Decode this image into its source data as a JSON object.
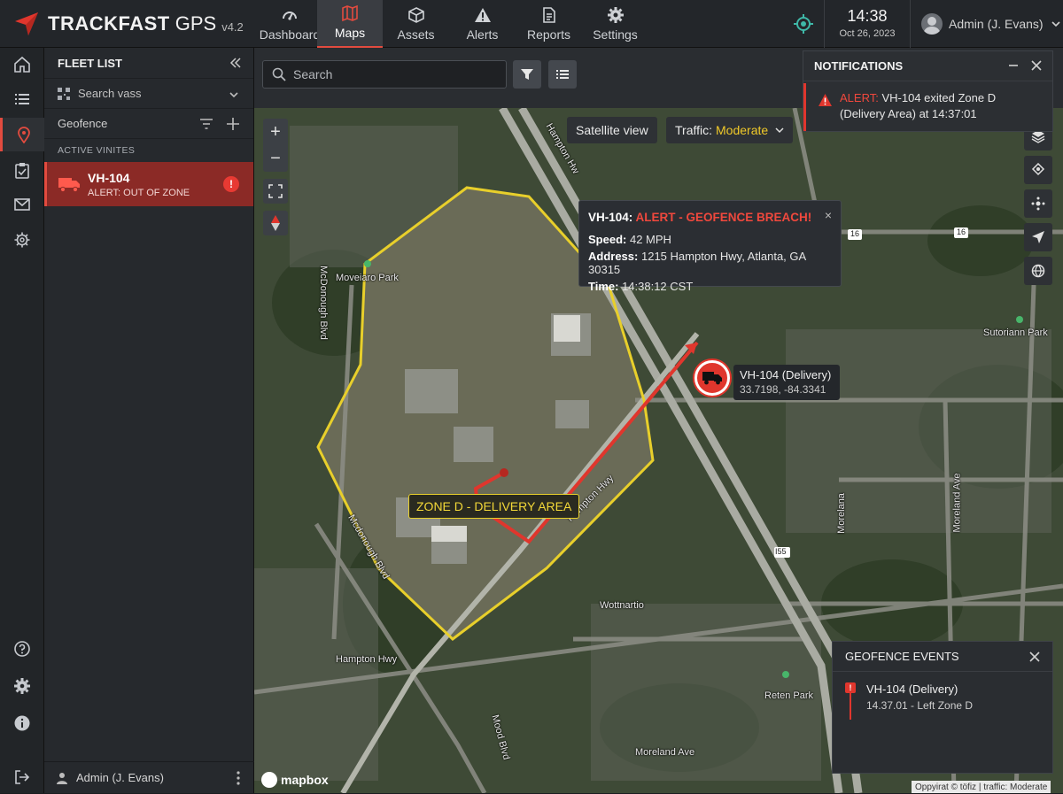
{
  "brand": {
    "name": "TRACKFAST",
    "suffix": "GPS",
    "version": "v4.2"
  },
  "nav": [
    {
      "label": "Dashboard",
      "icon": "dashboard-icon",
      "active": false
    },
    {
      "label": "Maps",
      "icon": "map-icon",
      "active": true
    },
    {
      "label": "Assets",
      "icon": "box-icon",
      "active": false
    },
    {
      "label": "Alerts",
      "icon": "warning-icon",
      "active": false
    },
    {
      "label": "Reports",
      "icon": "document-icon",
      "active": false
    },
    {
      "label": "Settings",
      "icon": "gear-icon",
      "active": false
    }
  ],
  "clock": {
    "time": "14:38",
    "date": "Oct 26, 2023"
  },
  "user": {
    "name": "Admin (J. Evans)"
  },
  "fleet": {
    "title": "FLEET LIST",
    "search_placeholder": "Search vass",
    "geofence_label": "Geofence",
    "section_label": "ACTIVE VINITES",
    "vehicles": [
      {
        "id": "VH-104",
        "status": "ALERT: OUT OF ZONE",
        "alert_badge": "!"
      }
    ],
    "footer_user": "Admin (J. Evans)"
  },
  "map": {
    "search_placeholder": "Search",
    "satellite_label": "Satellite view",
    "traffic_label": "Traffic:",
    "traffic_level": "Moderate",
    "zoom_in": "+",
    "zoom_out": "−",
    "zone_label": "ZONE D - DELIVERY AREA",
    "places": {
      "hampton_hwy": "Hampton Hwy",
      "hampton_hwy_diag": "Hampton Hwy",
      "moreland_ave": "Moreland Ave",
      "moreland_ave_v": "Moreland Ave",
      "moveland_park": "Moveiaro Park",
      "sutoriann_park": "Sutoriann Park",
      "reten_park": "Reten Park",
      "woodland": "Wottnartio",
      "moreland_vert": "Morelana",
      "mcdonough_vert": "McDonough Blvd",
      "mcdonough_vert2": "Mcdonough Blvd",
      "mood_vert": "Mood Blvd",
      "route_16a": "16",
      "route_16b": "16",
      "route_155": "I55",
      "hampton_top": "Hampton Hw"
    },
    "popup": {
      "vehicle": "VH-104:",
      "headline": "ALERT - GEOFENCE BREACH!",
      "speed_label": "Speed:",
      "speed_value": "42 MPH",
      "address_label": "Address:",
      "address_value": "1215 Hampton Hwy, Atlanta, GA 30315",
      "time_label": "Time:",
      "time_value": "14:38:12 CST",
      "close": "×"
    },
    "vehicle_marker": {
      "name": "VH-104 (Delivery)",
      "coords": "33.7198, -84.3341"
    },
    "logo": "mapbox",
    "attribution": "Oppyirat © töfiz | traffic: Moderate"
  },
  "notifications": {
    "title": "NOTIFICATIONS",
    "items": [
      {
        "prefix": "ALERT:",
        "text": "VH-104 exited Zone D (Delivery Area) at 14:37:01"
      }
    ]
  },
  "geofence_events": {
    "title": "GEOFENCE EVENTS",
    "items": [
      {
        "badge": "!",
        "name": "VH-104 (Delivery)",
        "detail": "14.37.01 - Left Zone D"
      }
    ]
  },
  "colors": {
    "accent_red": "#e0362d",
    "zone_yellow": "#e8cf2b",
    "traffic_yellow": "#f0c929",
    "panel_bg": "#26292d"
  }
}
